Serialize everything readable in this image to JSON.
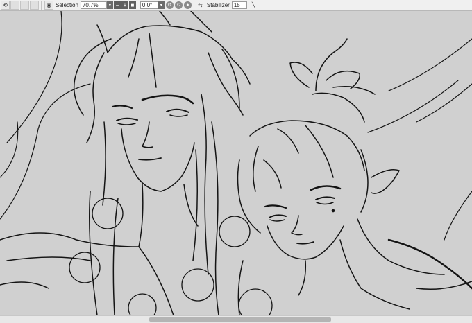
{
  "toolbar": {
    "tool_label": "Selection",
    "zoom_value": "70.7%",
    "rotation_value": "0.0°",
    "stabilizer_label": "Stabilizer",
    "stabilizer_value": "15",
    "icons": [
      "undo-icon",
      "eye-icon",
      "zoom-out-icon",
      "zoom-in-icon",
      "fit-icon",
      "rotate-left-icon",
      "rotate-right-icon",
      "reset-rotation-icon",
      "flip-icon",
      "line-tool-icon"
    ]
  },
  "canvas": {
    "background_color": "#d0d0d0",
    "stroke_color": "#141414",
    "content": "line-art sketch of two long-haired figures"
  },
  "scrollbar": {
    "orientation": "horizontal"
  }
}
